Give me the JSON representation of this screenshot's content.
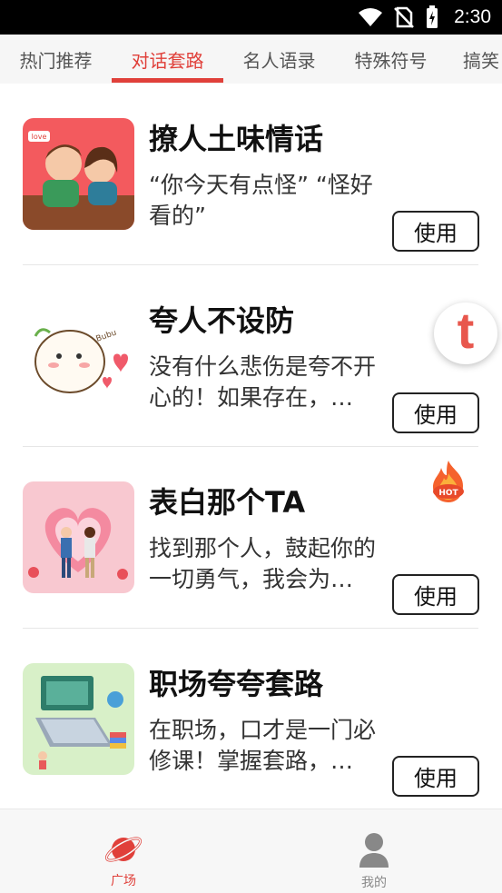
{
  "status_bar": {
    "time": "2:30"
  },
  "tabs": [
    {
      "label": "热门推荐",
      "active": false
    },
    {
      "label": "对话套路",
      "active": true
    },
    {
      "label": "名人语录",
      "active": false
    },
    {
      "label": "特殊符号",
      "active": false
    },
    {
      "label": "搞笑",
      "active": false
    }
  ],
  "items": [
    {
      "title": "撩人土味情话",
      "desc": "“你今天有点怪” “怪好看的”",
      "button": "使用",
      "thumb": "couple-illustration"
    },
    {
      "title": "夸人不设防",
      "desc": "没有什么悲伤是夸不开心的！如果存在，…",
      "button": "使用",
      "thumb": "cute-bun-sticker"
    },
    {
      "title": "表白那个TA",
      "desc": "找到那个人，鼓起你的一切勇气，我会为…",
      "button": "使用",
      "thumb": "love-confession-illustration",
      "badge": "HOT"
    },
    {
      "title": "职场夸夸套路",
      "desc": "在职场，口才是一门必修课！掌握套路，…",
      "button": "使用",
      "thumb": "workplace-illustration"
    }
  ],
  "floating_badge": "t",
  "bottom_nav": [
    {
      "label": "广场",
      "icon": "planet-icon",
      "active": true
    },
    {
      "label": "我的",
      "icon": "user-icon",
      "active": false
    }
  ],
  "colors": {
    "accent": "#e0403a",
    "inactive": "#888888",
    "status_bar": "#000000"
  }
}
